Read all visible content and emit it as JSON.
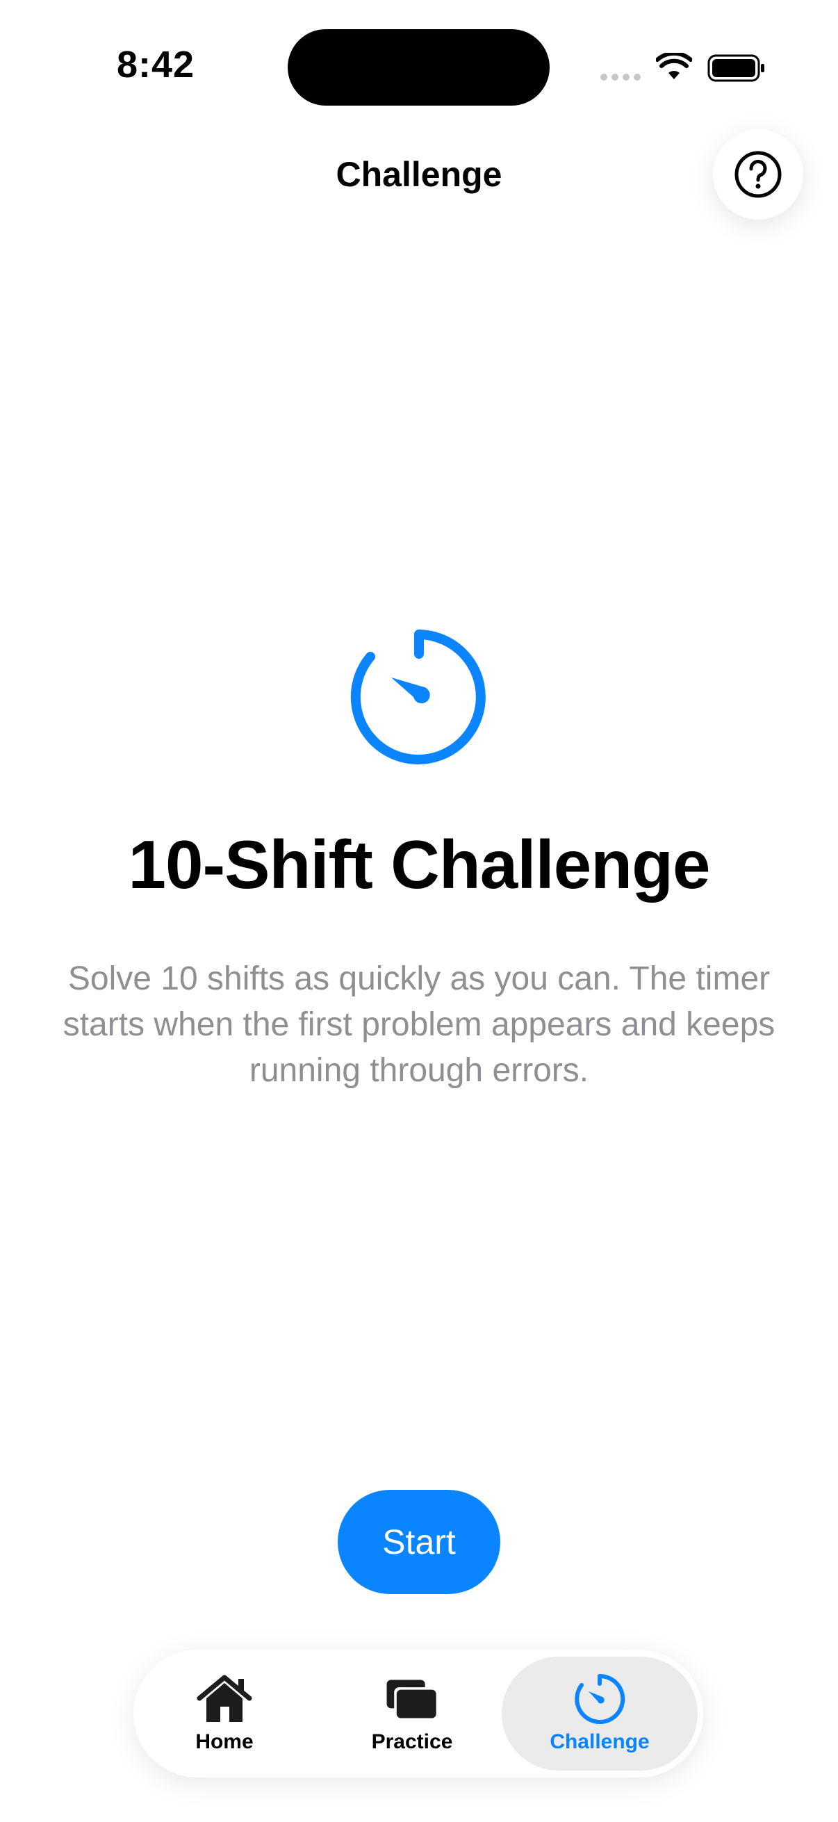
{
  "status_bar": {
    "time": "8:42"
  },
  "nav": {
    "title": "Challenge",
    "help_icon": "question-circle-icon"
  },
  "hero": {
    "icon": "timer-icon",
    "headline": "10-Shift Challenge",
    "description": "Solve 10 shifts as quickly as you can. The timer starts when the first problem appears and keeps running through errors."
  },
  "actions": {
    "start_label": "Start"
  },
  "tab_bar": {
    "items": [
      {
        "label": "Home",
        "icon": "house-icon"
      },
      {
        "label": "Practice",
        "icon": "cards-icon"
      },
      {
        "label": "Challenge",
        "icon": "timer-icon",
        "selected": true
      }
    ]
  },
  "colors": {
    "accent": "#0a84ff",
    "secondary_text": "#8e8e93",
    "tab_selected_bg": "#ebebeb"
  }
}
